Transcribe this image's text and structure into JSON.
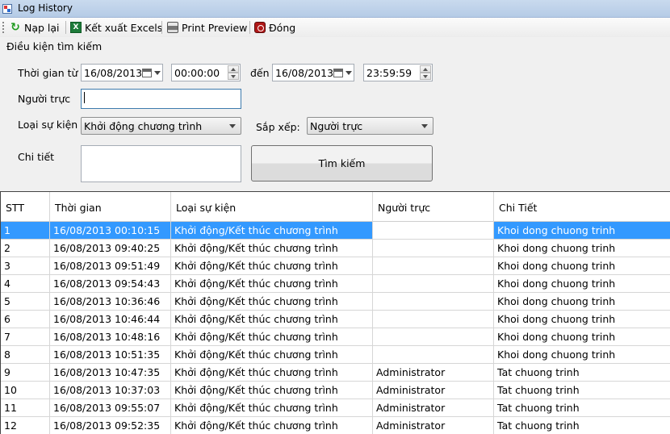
{
  "window": {
    "title": "Log History"
  },
  "toolbar": {
    "reload": "Nạp lại",
    "export_excel": "Kết xuất Excels",
    "print_preview": "Print Preview",
    "close": "Đóng"
  },
  "filters": {
    "group_title": "Điều kiện tìm kiếm",
    "time_from_label": "Thời gian từ",
    "date_from": "16/08/2013",
    "time_from": "00:00:00",
    "to_label": "đến",
    "date_to": "16/08/2013",
    "time_to": "23:59:59",
    "operator_label": "Người trực",
    "operator_value": "",
    "event_type_label": "Loại sự kiện",
    "event_type_value": "Khởi động chương trình",
    "sort_label": "Sắp xếp:",
    "sort_value": "Người trực",
    "detail_label": "Chi tiết",
    "detail_value": "",
    "search_button": "Tìm kiếm"
  },
  "grid": {
    "columns": [
      "STT",
      "Thời gian",
      "Loại sự kiện",
      "Người trực",
      "Chi Tiết"
    ],
    "rows": [
      [
        "1",
        "16/08/2013 00:10:15",
        "Khởi động/Kết thúc chương trình",
        "",
        "Khoi dong chuong trinh"
      ],
      [
        "2",
        "16/08/2013 09:40:25",
        "Khởi động/Kết thúc chương trình",
        "",
        "Khoi dong chuong trinh"
      ],
      [
        "3",
        "16/08/2013 09:51:49",
        "Khởi động/Kết thúc chương trình",
        "",
        "Khoi dong chuong trinh"
      ],
      [
        "4",
        "16/08/2013 09:54:43",
        "Khởi động/Kết thúc chương trình",
        "",
        "Khoi dong chuong trinh"
      ],
      [
        "5",
        "16/08/2013 10:36:46",
        "Khởi động/Kết thúc chương trình",
        "",
        "Khoi dong chuong trinh"
      ],
      [
        "6",
        "16/08/2013 10:46:44",
        "Khởi động/Kết thúc chương trình",
        "",
        "Khoi dong chuong trinh"
      ],
      [
        "7",
        "16/08/2013 10:48:16",
        "Khởi động/Kết thúc chương trình",
        "",
        "Khoi dong chuong trinh"
      ],
      [
        "8",
        "16/08/2013 10:51:35",
        "Khởi động/Kết thúc chương trình",
        "",
        "Khoi dong chuong trinh"
      ],
      [
        "9",
        "16/08/2013 10:47:35",
        "Khởi động/Kết thúc chương trình",
        "Administrator",
        "Tat chuong trinh"
      ],
      [
        "10",
        "16/08/2013 10:37:03",
        "Khởi động/Kết thúc chương trình",
        "Administrator",
        "Tat chuong trinh"
      ],
      [
        "11",
        "16/08/2013 09:55:07",
        "Khởi động/Kết thúc chương trình",
        "Administrator",
        "Tat chuong trinh"
      ],
      [
        "12",
        "16/08/2013 09:52:35",
        "Khởi động/Kết thúc chương trình",
        "Administrator",
        "Tat chuong trinh"
      ]
    ],
    "selected_index": 0,
    "selection_color": "#3399ff"
  }
}
